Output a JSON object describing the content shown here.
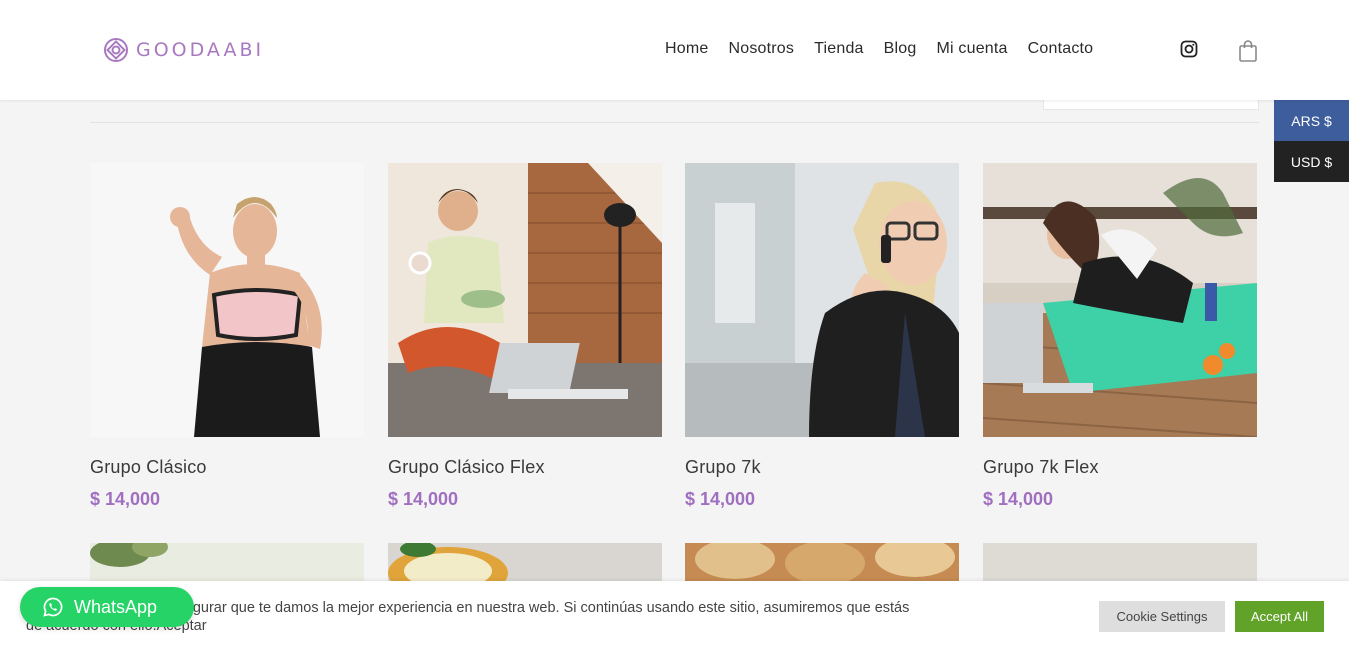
{
  "brand": {
    "name": "GOODAABI",
    "color": "#a979c0"
  },
  "nav": {
    "items": [
      "Home",
      "Nosotros",
      "Tienda",
      "Blog",
      "Mi cuenta",
      "Contacto"
    ]
  },
  "icons": {
    "social": "instagram-icon",
    "cart": "shopping-bag-icon",
    "whatsapp": "whatsapp-icon"
  },
  "currency": {
    "options": [
      "ARS $",
      "USD $"
    ],
    "selected": "ARS $"
  },
  "products": [
    {
      "title": "Grupo Clásico",
      "price": "$ 14,000"
    },
    {
      "title": "Grupo Clásico Flex",
      "price": "$ 14,000"
    },
    {
      "title": "Grupo 7k",
      "price": "$ 14,000"
    },
    {
      "title": "Grupo 7k Flex",
      "price": "$ 14,000"
    }
  ],
  "cookie": {
    "text": "Usamos cookies para asegurar que te damos la mejor experiencia en nuestra web. Si continúas usando este sitio, asumiremos que estás de acuerdo con ello.Aceptar",
    "settings_label": "Cookie Settings",
    "accept_label": "Accept All"
  },
  "whatsapp": {
    "label": "WhatsApp"
  },
  "colors": {
    "price": "#a06fc0",
    "accept": "#61a229",
    "whatsapp": "#25d366",
    "currency_active": "#3d5d9c"
  }
}
